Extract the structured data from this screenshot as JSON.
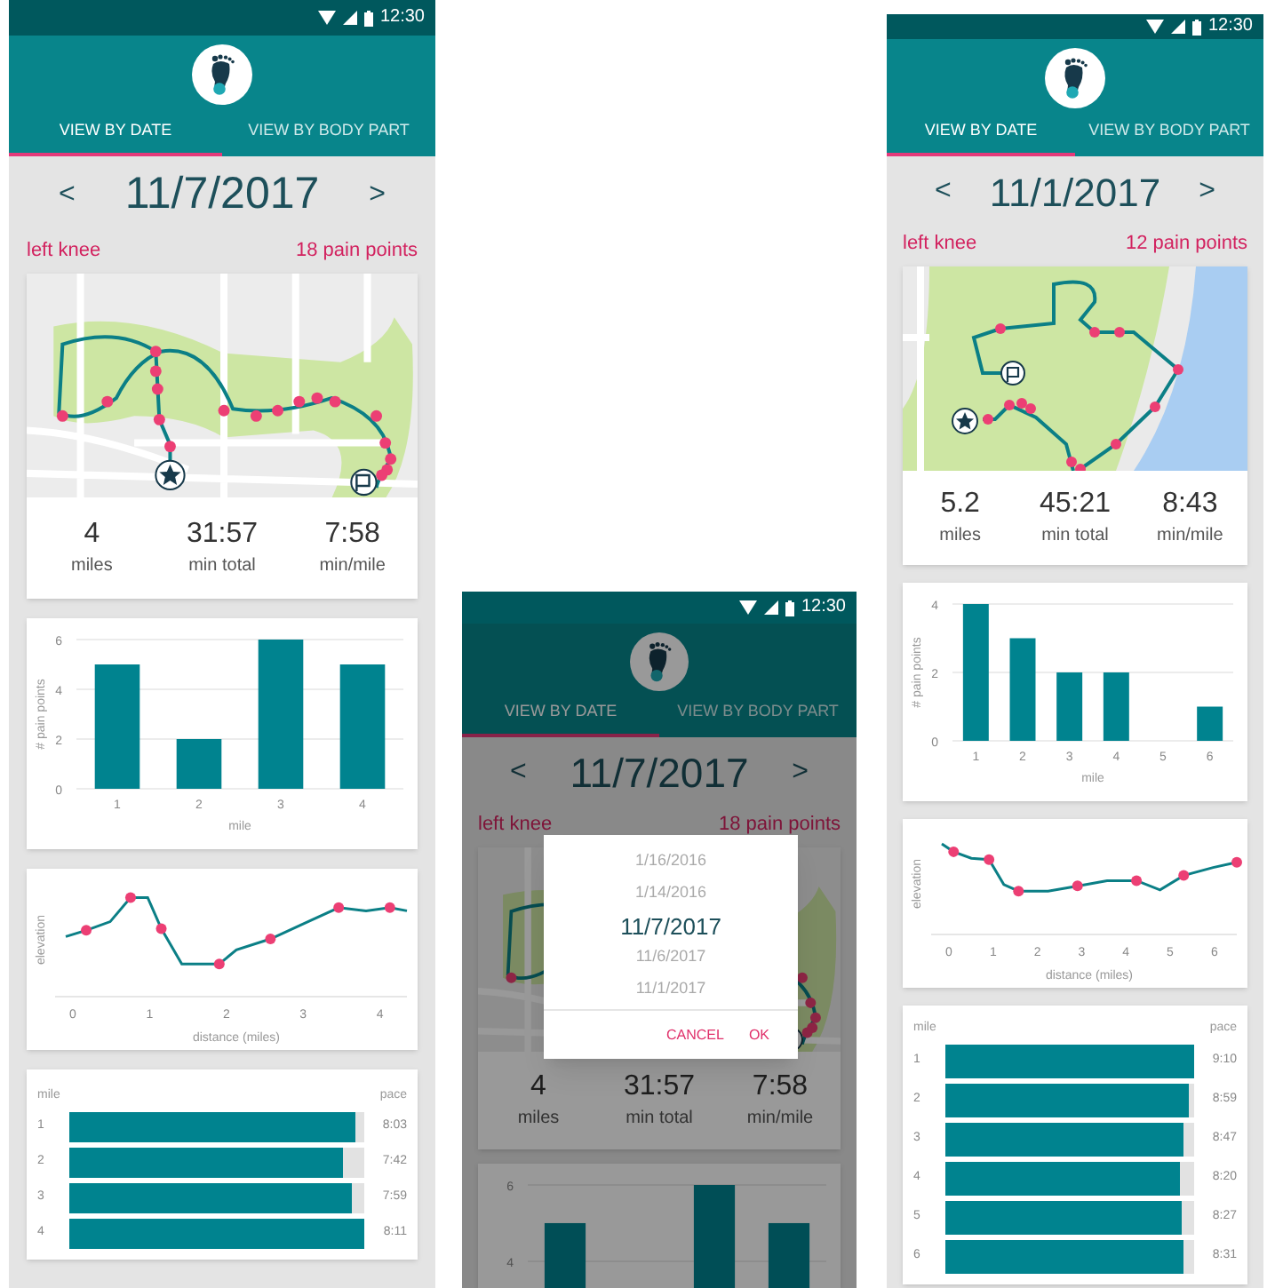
{
  "screens": [
    {
      "status_time": "12:30",
      "tabs": [
        {
          "label": "VIEW BY DATE",
          "selected": true
        },
        {
          "label": "VIEW BY BODY PART",
          "selected": false
        }
      ],
      "prev": "<",
      "date": "11/7/2017",
      "next": ">",
      "body_part": "left knee",
      "pain_count": "18 pain points",
      "stats": [
        {
          "value": "4",
          "label": "miles"
        },
        {
          "value": "31:57",
          "label": "min total"
        },
        {
          "value": "7:58",
          "label": "min/mile"
        }
      ],
      "pain_chart": {
        "chart_data": {
          "type": "bar",
          "ylabel": "# pain points",
          "xlabel": "mile",
          "categories": [
            "1",
            "2",
            "3",
            "4"
          ],
          "series": [
            {
              "color": "#00838f",
              "values": [
                5,
                2,
                6,
                5
              ]
            }
          ],
          "ylim": [
            0,
            6
          ],
          "yticks": [
            0,
            2,
            4,
            6
          ],
          "grid": true
        }
      },
      "elevation_chart": {
        "ylabel": "elevation",
        "xlabel": "distance (miles)",
        "xticks": [
          "0",
          "1",
          "2",
          "3",
          "4"
        ]
      },
      "pace_table": {
        "column_1": "mile",
        "column_2": "pace",
        "rows": [
          {
            "mile": "1",
            "pace": "8:03",
            "level": 0.97
          },
          {
            "mile": "2",
            "pace": "7:42",
            "level": 0.93
          },
          {
            "mile": "3",
            "pace": "7:59",
            "level": 0.96
          },
          {
            "mile": "4",
            "pace": "8:11",
            "level": 1.0
          }
        ]
      }
    },
    {
      "status_time": "12:30",
      "dimmed": true,
      "tabs": [
        {
          "label": "VIEW BY DATE",
          "selected": true
        },
        {
          "label": "VIEW BY BODY PART",
          "selected": false
        }
      ],
      "prev": "<",
      "date": "11/7/2017",
      "next": ">",
      "body_part": "left knee",
      "pain_count": "18 pain points",
      "stats": [
        {
          "value": "4",
          "label": "miles"
        },
        {
          "value": "31:57",
          "label": "min total"
        },
        {
          "value": "7:58",
          "label": "min/mile"
        }
      ],
      "pain_chart": {
        "chart_data": {
          "type": "bar",
          "series": [
            {
              "color": "#00838f",
              "values": [
                5,
                null,
                6,
                5
              ]
            }
          ],
          "ylim": [
            3.3,
            6
          ],
          "yticks": [
            4,
            6
          ],
          "grid": true
        }
      },
      "dialog": {
        "options": [
          {
            "label": "1/16/2016",
            "selected": false
          },
          {
            "label": "1/14/2016",
            "selected": false
          },
          {
            "label": "11/7/2017",
            "selected": true
          },
          {
            "label": "11/6/2017",
            "selected": false
          },
          {
            "label": "11/1/2017",
            "selected": false
          }
        ],
        "buttons": [
          "CANCEL",
          "OK"
        ]
      }
    },
    {
      "status_time": "12:30",
      "tabs": [
        {
          "label": "VIEW BY DATE",
          "selected": true
        },
        {
          "label": "VIEW BY BODY PART",
          "selected": false
        }
      ],
      "prev": "<",
      "date": "11/1/2017",
      "next": ">",
      "body_part": "left knee",
      "pain_count": "12 pain points",
      "stats": [
        {
          "value": "5.2",
          "label": "miles"
        },
        {
          "value": "45:21",
          "label": "min total"
        },
        {
          "value": "8:43",
          "label": "min/mile"
        }
      ],
      "pain_chart": {
        "chart_data": {
          "type": "bar",
          "ylabel": "# pain points",
          "xlabel": "mile",
          "categories": [
            "1",
            "2",
            "3",
            "4",
            "5",
            "6"
          ],
          "series": [
            {
              "color": "#00838f",
              "values": [
                4,
                3,
                2,
                2,
                0,
                1
              ]
            }
          ],
          "ylim": [
            0,
            4
          ],
          "yticks": [
            0,
            2,
            4
          ],
          "grid": true
        }
      },
      "elevation_chart": {
        "ylabel": "elevation",
        "xlabel": "distance (miles)",
        "xticks": [
          "0",
          "1",
          "2",
          "3",
          "4",
          "5",
          "6"
        ]
      },
      "pace_table": {
        "column_1": "mile",
        "column_2": "pace",
        "rows": [
          {
            "mile": "1",
            "pace": "9:10",
            "level": 1.0
          },
          {
            "mile": "2",
            "pace": "8:59",
            "level": 0.98
          },
          {
            "mile": "3",
            "pace": "8:47",
            "level": 0.96
          },
          {
            "mile": "4",
            "pace": "8:20",
            "level": 0.94
          },
          {
            "mile": "5",
            "pace": "8:27",
            "level": 0.95
          },
          {
            "mile": "6",
            "pace": "8:31",
            "level": 0.96
          }
        ]
      }
    }
  ]
}
